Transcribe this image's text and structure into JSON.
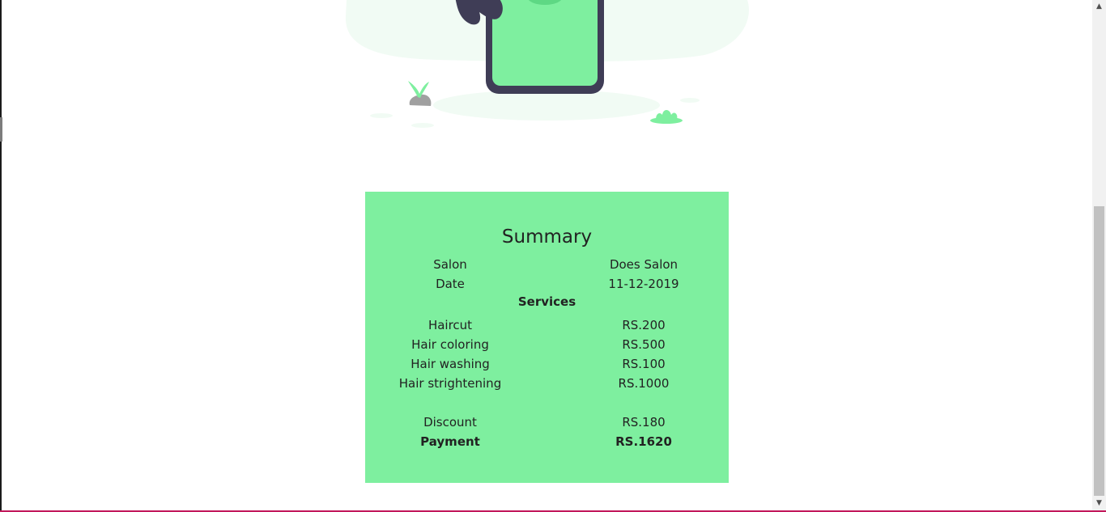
{
  "illustration": {
    "name": "payment-phone-illustration",
    "colors": {
      "blob": "#f1fbf4",
      "phone_frame": "#3f3d56",
      "phone_screen": "#7eef9f",
      "plant": "#7eef9f",
      "rock": "#a0a0a0"
    }
  },
  "summary": {
    "title": "Summary",
    "salon_label": "Salon",
    "salon_value": "Does Salon",
    "date_label": "Date",
    "date_value": "11-12-2019",
    "services_heading": "Services",
    "services": [
      {
        "name": "Haircut",
        "price": "RS.200"
      },
      {
        "name": "Hair coloring",
        "price": "RS.500"
      },
      {
        "name": "Hair washing",
        "price": "RS.100"
      },
      {
        "name": "Hair strightening",
        "price": "RS.1000"
      }
    ],
    "discount_label": "Discount",
    "discount_value": "RS.180",
    "payment_label": "Payment",
    "payment_value": "RS.1620",
    "background_color": "#7eef9f"
  },
  "scrollbar": {
    "up_icon": "▲",
    "down_icon": "▼"
  }
}
